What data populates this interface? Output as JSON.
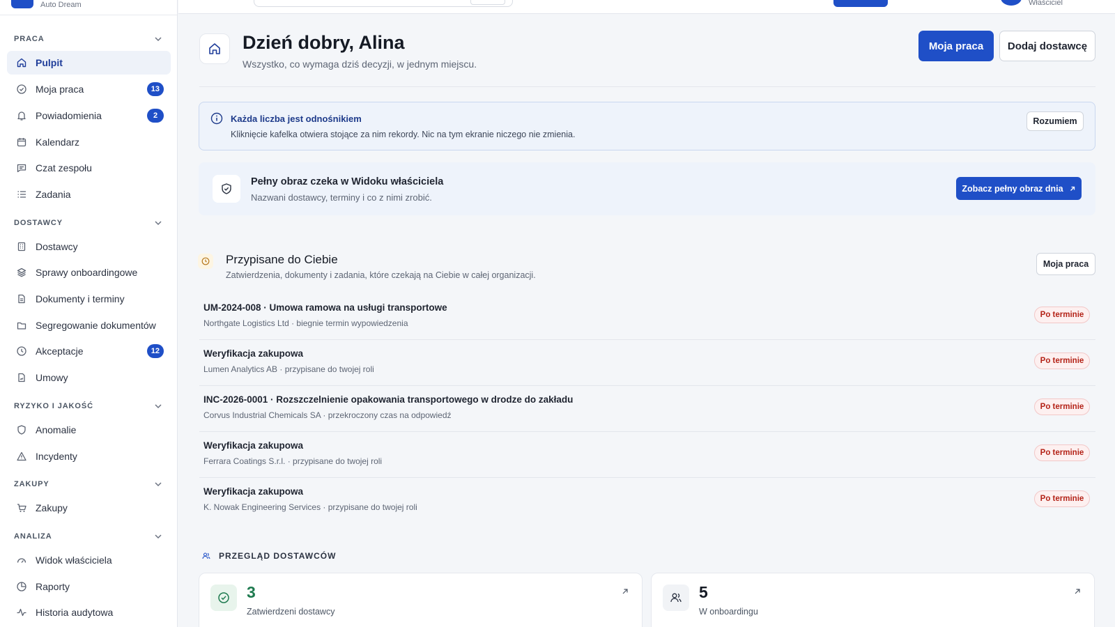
{
  "brand": {
    "name": "Auto Dream"
  },
  "topbar": {
    "role": "Właściciel"
  },
  "sidebar": {
    "sections": [
      {
        "title": "PRACA",
        "items": [
          {
            "label": "Pulpit",
            "active": true
          },
          {
            "label": "Moja praca",
            "badge": "13"
          },
          {
            "label": "Powiadomienia",
            "badge": "2"
          },
          {
            "label": "Kalendarz"
          },
          {
            "label": "Czat zespołu"
          },
          {
            "label": "Zadania"
          }
        ]
      },
      {
        "title": "DOSTAWCY",
        "items": [
          {
            "label": "Dostawcy"
          },
          {
            "label": "Sprawy onboardingowe"
          },
          {
            "label": "Dokumenty i terminy"
          },
          {
            "label": "Segregowanie dokumentów"
          },
          {
            "label": "Akceptacje",
            "badge": "12"
          },
          {
            "label": "Umowy"
          }
        ]
      },
      {
        "title": "RYZYKO I JAKOŚĆ",
        "items": [
          {
            "label": "Anomalie"
          },
          {
            "label": "Incydenty"
          }
        ]
      },
      {
        "title": "ZAKUPY",
        "items": [
          {
            "label": "Zakupy"
          }
        ]
      },
      {
        "title": "ANALIZA",
        "items": [
          {
            "label": "Widok właściciela"
          },
          {
            "label": "Raporty"
          },
          {
            "label": "Historia audytowa"
          }
        ]
      }
    ]
  },
  "header": {
    "greeting": "Dzień dobry, Alina",
    "subtitle": "Wszystko, co wymaga dziś decyzji, w jednym miejscu.",
    "primary_button": "Moja praca",
    "secondary_button": "Dodaj dostawcę"
  },
  "info": {
    "title": "Każda liczba jest odnośnikiem",
    "text": "Kliknięcie kafelka otwiera stojące za nim rekordy. Nic na tym ekranie niczego nie zmienia.",
    "button": "Rozumiem"
  },
  "owner": {
    "title": "Pełny obraz czeka w Widoku właściciela",
    "text": "Nazwani dostawcy, terminy i co z nimi zrobić.",
    "button": "Zobacz pełny obraz dnia"
  },
  "assigned": {
    "title": "Przypisane do Ciebie",
    "subtitle": "Zatwierdzenia, dokumenty i zadania, które czekają na Ciebie w całej organizacji.",
    "button": "Moja praca",
    "rows": [
      {
        "title": "UM-2024-008 · Umowa ramowa na usługi transportowe",
        "sub": "Northgate Logistics Ltd · biegnie termin wypowiedzenia",
        "badge": "Po terminie"
      },
      {
        "title": "Weryfikacja zakupowa",
        "sub": "Lumen Analytics AB · przypisane do twojej roli",
        "badge": "Po terminie"
      },
      {
        "title": "INC-2026-0001 · Rozszczelnienie opakowania transportowego w drodze do zakładu",
        "sub": "Corvus Industrial Chemicals SA · przekroczony czas na odpowiedź",
        "badge": "Po terminie"
      },
      {
        "title": "Weryfikacja zakupowa",
        "sub": "Ferrara Coatings S.r.l. · przypisane do twojej roli",
        "badge": "Po terminie"
      },
      {
        "title": "Weryfikacja zakupowa",
        "sub": "K. Nowak Engineering Services · przypisane do twojej roli",
        "badge": "Po terminie"
      }
    ]
  },
  "overview": {
    "title": "PRZEGLĄD DOSTAWCÓW",
    "cards": [
      {
        "value": "3",
        "label": "Zatwierdzeni dostawcy",
        "accent": "#1e7a4f"
      },
      {
        "value": "5",
        "label": "W onboardingu",
        "accent": "#151a24"
      }
    ]
  },
  "colors": {
    "accent": "#1f4fc7",
    "overdue": "#b42318",
    "approved": "#1e7a4f"
  }
}
